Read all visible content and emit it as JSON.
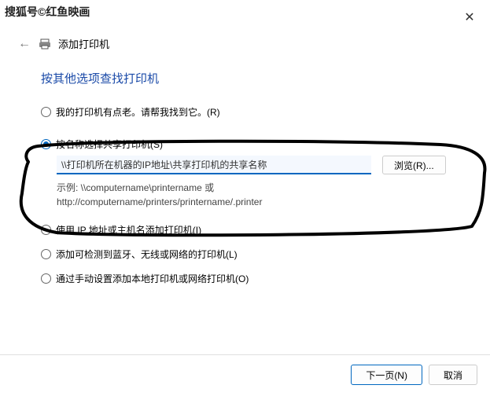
{
  "watermark": "搜狐号©红鱼映画",
  "header": {
    "title": "添加打印机"
  },
  "section_title": "按其他选项查找打印机",
  "options": {
    "opt1": {
      "label": "我的打印机有点老。请帮我找到它。(R)"
    },
    "opt2": {
      "label": "按名称选择共享打印机(S)"
    },
    "input_value": "\\\\打印机所在机器的IP地址\\共享打印机的共享名称",
    "browse_label": "浏览(R)...",
    "example_line1": "示例: \\\\computername\\printername 或",
    "example_line2": "http://computername/printers/printername/.printer",
    "opt3": {
      "label": "使用 IP 地址或主机名添加打印机(I)"
    },
    "opt4": {
      "label": "添加可检测到蓝牙、无线或网络的打印机(L)"
    },
    "opt5": {
      "label": "通过手动设置添加本地打印机或网络打印机(O)"
    }
  },
  "footer": {
    "next": "下一页(N)",
    "cancel": "取消"
  }
}
